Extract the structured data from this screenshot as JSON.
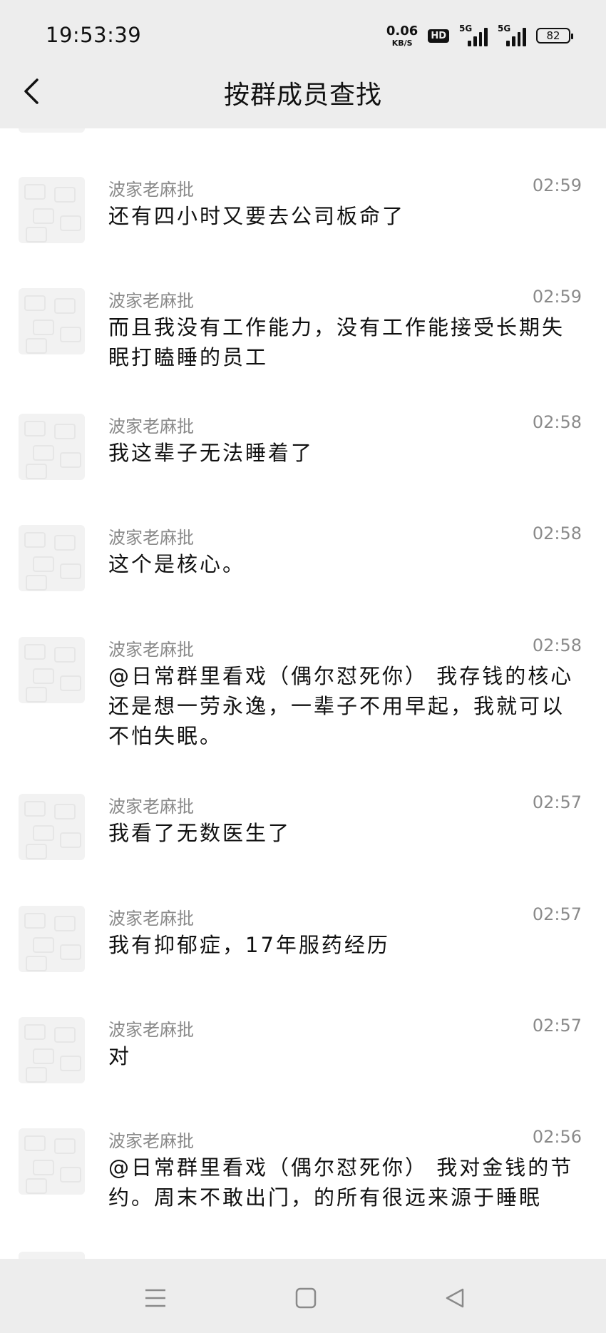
{
  "status_bar": {
    "time": "19:53:39",
    "net_speed_value": "0.06",
    "net_speed_unit": "KB/S",
    "hd_badge": "HD",
    "signal1_label": "5G",
    "signal2_label": "5G",
    "battery": "82"
  },
  "header": {
    "title": "按群成员查找",
    "back_icon": "chevron-left-icon"
  },
  "messages": [
    {
      "sender": "波家老麻批",
      "time": "02:59",
      "text": "还有四小时又要去公司板命了"
    },
    {
      "sender": "波家老麻批",
      "time": "02:59",
      "text": "而且我没有工作能力，没有工作能接受长期失眠打瞌睡的员工"
    },
    {
      "sender": "波家老麻批",
      "time": "02:58",
      "text": "我这辈子无法睡着了"
    },
    {
      "sender": "波家老麻批",
      "time": "02:58",
      "text": "这个是核心。"
    },
    {
      "sender": "波家老麻批",
      "time": "02:58",
      "text": "@日常群里看戏（偶尔怼死你） 我存钱的核心还是想一劳永逸，一辈子不用早起，我就可以不怕失眠。"
    },
    {
      "sender": "波家老麻批",
      "time": "02:57",
      "text": "我看了无数医生了"
    },
    {
      "sender": "波家老麻批",
      "time": "02:57",
      "text": "我有抑郁症，17年服药经历"
    },
    {
      "sender": "波家老麻批",
      "time": "02:57",
      "text": "对"
    },
    {
      "sender": "波家老麻批",
      "time": "02:56",
      "text": "@日常群里看戏（偶尔怼死你） 我对金钱的节约。周末不敢出门，的所有很远来源于睡眠"
    }
  ],
  "nav": {
    "menu_icon": "menu-icon",
    "home_icon": "square-home-icon",
    "back_icon": "triangle-back-icon"
  },
  "colors": {
    "bar_bg": "#ededed",
    "meta_text": "#8a8a8a",
    "avatar_bg": "#f2f2f2"
  }
}
